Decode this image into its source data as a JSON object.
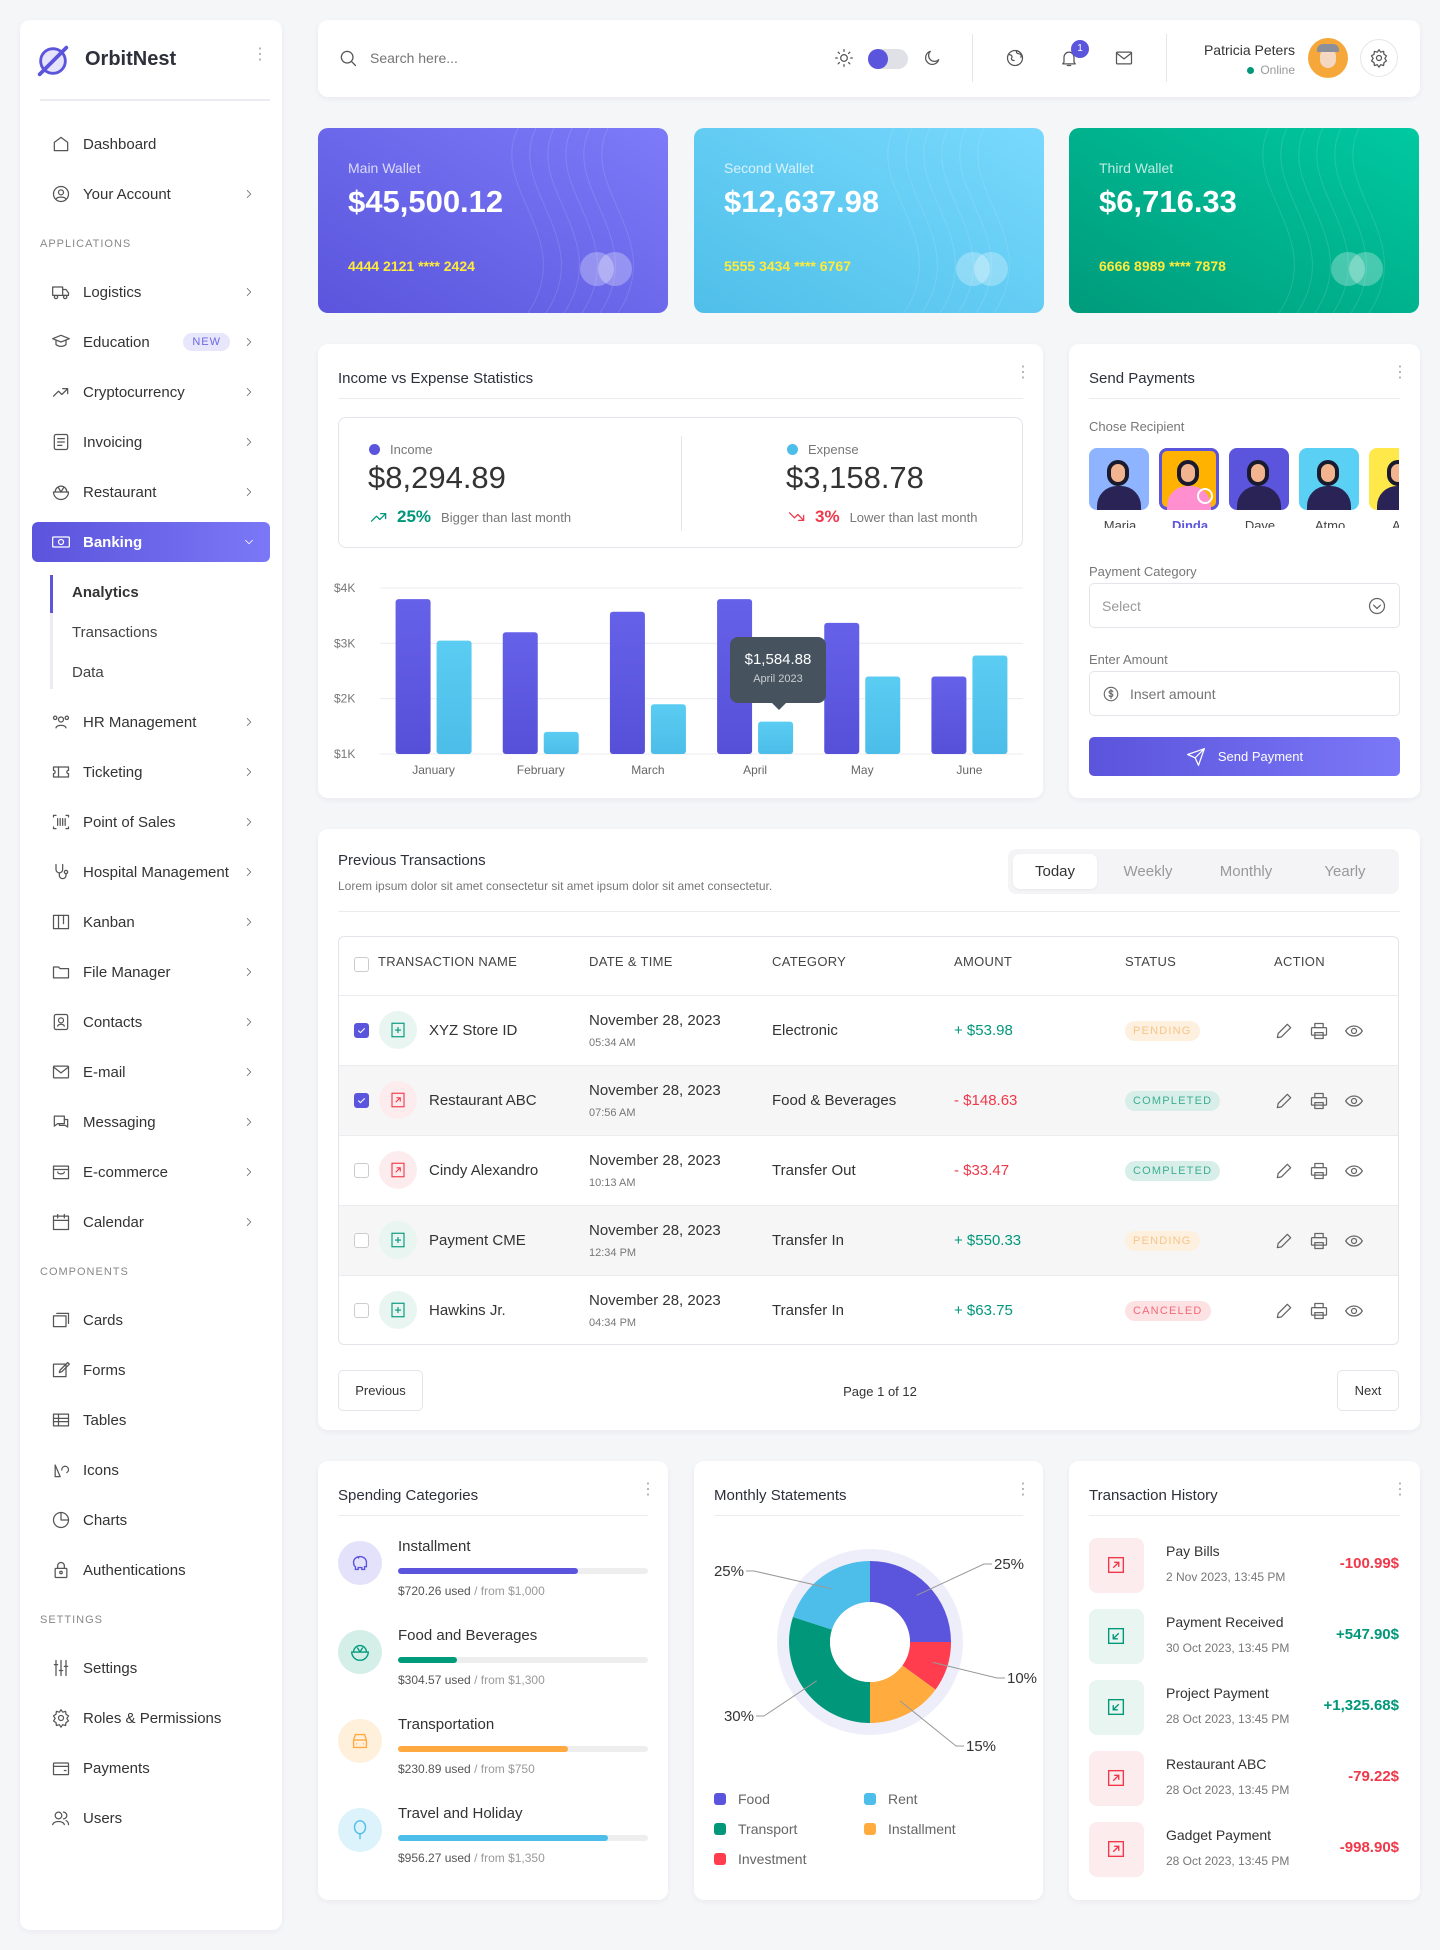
{
  "app": {
    "name": "OrbitNest"
  },
  "sidebar": {
    "sections": [
      {
        "label": "",
        "items": [
          {
            "label": "Dashboard",
            "icon": "home-icon",
            "chevron": false
          },
          {
            "label": "Your Account",
            "icon": "user-circle-icon",
            "chevron": true
          }
        ]
      },
      {
        "label": "APPLICATIONS",
        "items": [
          {
            "label": "Logistics",
            "icon": "truck-icon",
            "chevron": true
          },
          {
            "label": "Education",
            "icon": "graduation-icon",
            "chevron": true,
            "badge": "NEW"
          },
          {
            "label": "Cryptocurrency",
            "icon": "trending-up-icon",
            "chevron": true
          },
          {
            "label": "Invoicing",
            "icon": "invoice-icon",
            "chevron": true
          },
          {
            "label": "Restaurant",
            "icon": "bowl-icon",
            "chevron": true
          },
          {
            "label": "Banking",
            "icon": "banknote-icon",
            "chevron": true,
            "active": true,
            "children": [
              "Analytics",
              "Transactions",
              "Data"
            ]
          },
          {
            "label": "HR Management",
            "icon": "users-group-icon",
            "chevron": true
          },
          {
            "label": "Ticketing",
            "icon": "ticket-icon",
            "chevron": true
          },
          {
            "label": "Point of Sales",
            "icon": "barcode-icon",
            "chevron": true
          },
          {
            "label": "Hospital Management",
            "icon": "stethoscope-icon",
            "chevron": true
          },
          {
            "label": "Kanban",
            "icon": "kanban-icon",
            "chevron": true
          },
          {
            "label": "File Manager",
            "icon": "folder-icon",
            "chevron": true
          },
          {
            "label": "Contacts",
            "icon": "contact-icon",
            "chevron": true
          },
          {
            "label": "E-mail",
            "icon": "mail-icon",
            "chevron": true
          },
          {
            "label": "Messaging",
            "icon": "chat-icon",
            "chevron": true
          },
          {
            "label": "E-commerce",
            "icon": "shop-icon",
            "chevron": true
          },
          {
            "label": "Calendar",
            "icon": "calendar-icon",
            "chevron": true
          }
        ]
      },
      {
        "label": "COMPONENTS",
        "items": [
          {
            "label": "Cards",
            "icon": "cards-icon",
            "chevron": false
          },
          {
            "label": "Forms",
            "icon": "edit-icon",
            "chevron": false
          },
          {
            "label": "Tables",
            "icon": "table-icon",
            "chevron": false
          },
          {
            "label": "Icons",
            "icon": "shapes-icon",
            "chevron": false
          },
          {
            "label": "Charts",
            "icon": "pie-icon",
            "chevron": false
          },
          {
            "label": "Authentications",
            "icon": "lock-icon",
            "chevron": false
          }
        ]
      },
      {
        "label": "SETTINGS",
        "items": [
          {
            "label": "Settings",
            "icon": "sliders-icon",
            "chevron": false
          },
          {
            "label": "Roles & Permissions",
            "icon": "gear-icon",
            "chevron": false
          },
          {
            "label": "Payments",
            "icon": "wallet-icon",
            "chevron": false
          },
          {
            "label": "Users",
            "icon": "users-icon",
            "chevron": false
          }
        ]
      }
    ],
    "active_child": "Analytics"
  },
  "header": {
    "search_placeholder": "Search here...",
    "notification_count": "1",
    "user_name": "Patricia Peters",
    "user_status": "Online",
    "theme_toggle": "light"
  },
  "wallets": [
    {
      "label": "Main Wallet",
      "amount": "$45,500.12",
      "number": "4444 2121 **** 2424",
      "color_from": "#5a55dc",
      "color_to": "#7d7bf9"
    },
    {
      "label": "Second Wallet",
      "amount": "$12,637.98",
      "number": "5555 3434 **** 6767",
      "color_from": "#4fbfe9",
      "color_to": "#78d9fd"
    },
    {
      "label": "Third Wallet",
      "amount": "$6,716.33",
      "number": "6666 8989 **** 7878",
      "color_from": "#009b7b",
      "color_to": "#00c9a1"
    }
  ],
  "income_expense": {
    "title": "Income vs Expense Statistics",
    "income": {
      "label": "Income",
      "amount": "$8,294.89",
      "pct": "25%",
      "note": "Bigger than last month"
    },
    "expense": {
      "label": "Expense",
      "amount": "$3,158.78",
      "pct": "3%",
      "note": "Lower than last month"
    },
    "tooltip": {
      "value": "$1,584.88",
      "label": "April 2023"
    }
  },
  "chart_data": {
    "type": "bar",
    "categories": [
      "January",
      "February",
      "March",
      "April",
      "May",
      "June"
    ],
    "series": [
      {
        "name": "Income",
        "color": "#6561e8",
        "values": [
          3800,
          3200,
          3570,
          3800,
          3370,
          2400
        ]
      },
      {
        "name": "Expense",
        "color": "#5bcdf3",
        "values": [
          3050,
          1400,
          1900,
          1585,
          2400,
          2780
        ]
      }
    ],
    "yticks": [
      "$1K",
      "$2K",
      "$3K",
      "$4K"
    ],
    "ylim": [
      1000,
      4000
    ],
    "grid": true
  },
  "send_payments": {
    "title": "Send Payments",
    "recipient_label": "Chose Recipient",
    "recipients": [
      {
        "name": "Maria",
        "bg": "#8fb4ff",
        "selected": false
      },
      {
        "name": "Dinda",
        "bg": "#ffb300",
        "selected": true
      },
      {
        "name": "Dave",
        "bg": "#5b54dc",
        "selected": false
      },
      {
        "name": "Atmo",
        "bg": "#5bd0f5",
        "selected": false
      },
      {
        "name": "An",
        "bg": "#ffe94a",
        "selected": false
      }
    ],
    "category_label": "Payment Category",
    "category_value": "Select",
    "amount_label": "Enter Amount",
    "amount_placeholder": "Insert amount",
    "button": "Send Payment"
  },
  "transactions": {
    "title": "Previous Transactions",
    "subtitle": "Lorem ipsum dolor sit amet consectetur sit amet ipsum dolor sit amet consectetur.",
    "tabs": [
      "Today",
      "Weekly",
      "Monthly",
      "Yearly"
    ],
    "active_tab": "Today",
    "columns": [
      "TRANSACTION NAME",
      "DATE & TIME",
      "CATEGORY",
      "AMOUNT",
      "STATUS",
      "ACTION"
    ],
    "rows": [
      {
        "checked": true,
        "type": "in",
        "name": "XYZ Store ID",
        "date": "November 28, 2023",
        "time": "05:34 AM",
        "category": "Electronic",
        "amount": "+ $53.98",
        "status": "PENDING"
      },
      {
        "checked": true,
        "type": "out",
        "name": "Restaurant ABC",
        "date": "November 28, 2023",
        "time": "07:56 AM",
        "category": "Food & Beverages",
        "amount": "- $148.63",
        "status": "COMPLETED"
      },
      {
        "checked": false,
        "type": "out",
        "name": "Cindy Alexandro",
        "date": "November 28, 2023",
        "time": "10:13 AM",
        "category": "Transfer Out",
        "amount": "- $33.47",
        "status": "COMPLETED"
      },
      {
        "checked": false,
        "type": "in",
        "name": "Payment CME",
        "date": "November 28, 2023",
        "time": "12:34 PM",
        "category": "Transfer In",
        "amount": "+ $550.33",
        "status": "PENDING"
      },
      {
        "checked": false,
        "type": "in",
        "name": "Hawkins Jr.",
        "date": "November 28, 2023",
        "time": "04:34 PM",
        "category": "Transfer In",
        "amount": "+ $63.75",
        "status": "CANCELED"
      }
    ],
    "pagination": {
      "previous": "Previous",
      "page": "Page 1 of 12",
      "next": "Next"
    }
  },
  "spending": {
    "title": "Spending Categories",
    "items": [
      {
        "name": "Installment",
        "used": "$720.26 used",
        "from": " / from $1,000",
        "progress": 0.72,
        "color": "#5b54dc",
        "bg": "#e3e2fa",
        "icon": "piggy-bank-icon"
      },
      {
        "name": "Food and Beverages",
        "used": "$304.57 used",
        "from": " / from $1,300",
        "progress": 0.234,
        "color": "#009b7b",
        "bg": "#d4efe8",
        "icon": "bowl-icon"
      },
      {
        "name": "Transportation",
        "used": "$230.89 used",
        "from": " / from $750",
        "progress": 0.68,
        "color": "#ffa940",
        "bg": "#fff0dc",
        "icon": "car-icon"
      },
      {
        "name": "Travel and Holiday",
        "used": "$956.27 used",
        "from": " / from $1,350",
        "progress": 0.84,
        "color": "#4dbde9",
        "bg": "#dcf3fc",
        "icon": "balloon-icon"
      }
    ]
  },
  "monthly_statements": {
    "title": "Monthly Statements",
    "slices": [
      {
        "name": "Food",
        "value": 25,
        "label": "25%",
        "color": "#5b54dc"
      },
      {
        "name": "Investment",
        "value": 10,
        "label": "10%",
        "color": "#ff3d4f"
      },
      {
        "name": "Installment",
        "value": 15,
        "label": "15%",
        "color": "#ffab3d"
      },
      {
        "name": "Transport",
        "value": 30,
        "label": "30%",
        "color": "#00977a"
      },
      {
        "name": "Rent",
        "value": 20,
        "label": "25%",
        "color": "#4dbde9"
      }
    ],
    "legend": [
      "Food",
      "Rent",
      "Transport",
      "Installment",
      "Investment"
    ]
  },
  "history": {
    "title": "Transaction History",
    "items": [
      {
        "name": "Pay Bills",
        "date": "2 Nov 2023, 13:45 PM",
        "amount": "-100.99$",
        "type": "out"
      },
      {
        "name": "Payment Received",
        "date": "30 Oct 2023, 13:45 PM",
        "amount": "+547.90$",
        "type": "in"
      },
      {
        "name": "Project Payment",
        "date": "28 Oct 2023, 13:45 PM",
        "amount": "+1,325.68$",
        "type": "in"
      },
      {
        "name": "Restaurant ABC",
        "date": "28 Oct 2023, 13:45 PM",
        "amount": "-79.22$",
        "type": "out"
      },
      {
        "name": "Gadget Payment",
        "date": "28 Oct 2023, 13:45 PM",
        "amount": "-998.90$",
        "type": "out"
      }
    ]
  },
  "colors": {
    "accent": "#5b54dc",
    "positive": "#00977a",
    "negative": "#f0384a"
  }
}
